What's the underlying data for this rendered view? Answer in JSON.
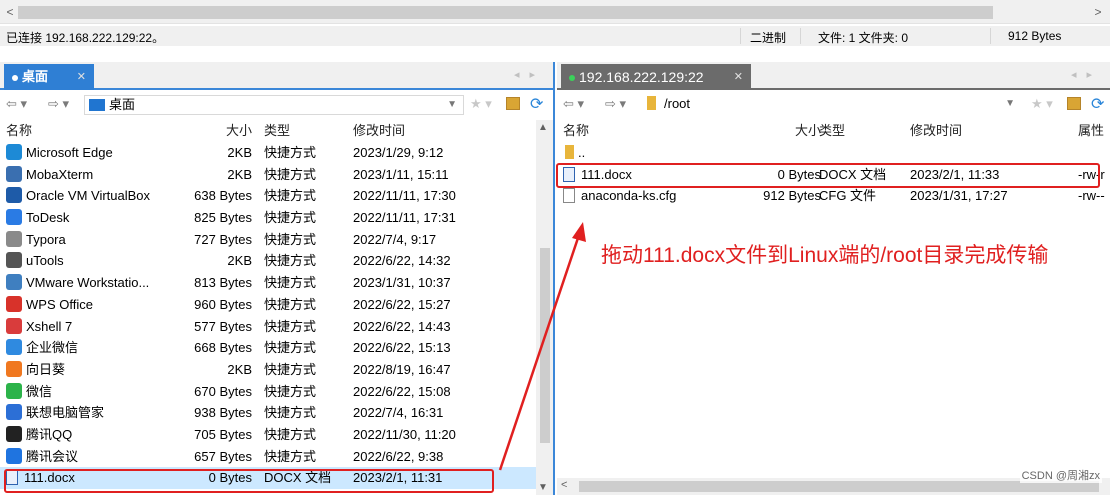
{
  "status_bar": {
    "connection": "已连接 192.168.222.129:22。",
    "mode": "二进制",
    "counts": "文件: 1  文件夹: 0",
    "size": "912 Bytes"
  },
  "left_panel": {
    "tab_label": "桌面",
    "address": "桌面",
    "columns": {
      "name": "名称",
      "size": "大小",
      "type": "类型",
      "modified": "修改时间"
    },
    "files": [
      {
        "name": "Microsoft Edge",
        "size": "2KB",
        "type": "快捷方式",
        "modified": "2023/1/29, 9:12",
        "icon": "edge-icon",
        "color": "#1d8ad6"
      },
      {
        "name": "MobaXterm",
        "size": "2KB",
        "type": "快捷方式",
        "modified": "2023/1/11, 15:11",
        "icon": "mobaxterm-icon",
        "color": "#3a6fb0"
      },
      {
        "name": "Oracle VM VirtualBox",
        "size": "638 Bytes",
        "type": "快捷方式",
        "modified": "2022/11/11, 17:30",
        "icon": "virtualbox-icon",
        "color": "#1e5ba8"
      },
      {
        "name": "ToDesk",
        "size": "825 Bytes",
        "type": "快捷方式",
        "modified": "2022/11/11, 17:31",
        "icon": "todesk-icon",
        "color": "#2a7be4"
      },
      {
        "name": "Typora",
        "size": "727 Bytes",
        "type": "快捷方式",
        "modified": "2022/7/4, 9:17",
        "icon": "typora-icon",
        "color": "#8a8a8a"
      },
      {
        "name": "uTools",
        "size": "2KB",
        "type": "快捷方式",
        "modified": "2022/6/22, 14:32",
        "icon": "utools-icon",
        "color": "#555555"
      },
      {
        "name": "VMware Workstatio...",
        "size": "813 Bytes",
        "type": "快捷方式",
        "modified": "2023/1/31, 10:37",
        "icon": "vmware-icon",
        "color": "#3f7fc0"
      },
      {
        "name": "WPS Office",
        "size": "960 Bytes",
        "type": "快捷方式",
        "modified": "2022/6/22, 15:27",
        "icon": "wps-icon",
        "color": "#d8322a"
      },
      {
        "name": "Xshell 7",
        "size": "577 Bytes",
        "type": "快捷方式",
        "modified": "2022/6/22, 14:43",
        "icon": "xshell-icon",
        "color": "#d93c3c"
      },
      {
        "name": "企业微信",
        "size": "668 Bytes",
        "type": "快捷方式",
        "modified": "2022/6/22, 15:13",
        "icon": "wecom-icon",
        "color": "#2f8ae0"
      },
      {
        "name": "向日葵",
        "size": "2KB",
        "type": "快捷方式",
        "modified": "2022/8/19, 16:47",
        "icon": "sunflower-icon",
        "color": "#f07820"
      },
      {
        "name": "微信",
        "size": "670 Bytes",
        "type": "快捷方式",
        "modified": "2022/6/22, 15:08",
        "icon": "wechat-icon",
        "color": "#2cb34a"
      },
      {
        "name": "联想电脑管家",
        "size": "938 Bytes",
        "type": "快捷方式",
        "modified": "2022/7/4, 16:31",
        "icon": "lenovo-icon",
        "color": "#2c6fd6"
      },
      {
        "name": "腾讯QQ",
        "size": "705 Bytes",
        "type": "快捷方式",
        "modified": "2022/11/30, 11:20",
        "icon": "qq-icon",
        "color": "#222222"
      },
      {
        "name": "腾讯会议",
        "size": "657 Bytes",
        "type": "快捷方式",
        "modified": "2022/6/22, 9:38",
        "icon": "tencent-meeting-icon",
        "color": "#1f74e0"
      },
      {
        "name": "111.docx",
        "size": "0 Bytes",
        "type": "DOCX 文档",
        "modified": "2023/2/1, 11:31",
        "icon": "docx-file-icon",
        "color": "#2f63b0"
      }
    ]
  },
  "right_panel": {
    "tab_label": "192.168.222.129:22",
    "address": "/root",
    "columns": {
      "name": "名称",
      "size": "大小",
      "type": "类型",
      "modified": "修改时间",
      "attributes": "属性"
    },
    "parent_label": "..",
    "files": [
      {
        "name": "111.docx",
        "size": "0 Bytes",
        "type": "DOCX 文档",
        "modified": "2023/2/1, 11:33",
        "attributes": "-rw-r",
        "icon": "docx-file-icon"
      },
      {
        "name": "anaconda-ks.cfg",
        "size": "912 Bytes",
        "type": "CFG 文件",
        "modified": "2023/1/31, 17:27",
        "attributes": "-rw--",
        "icon": "file-icon"
      }
    ]
  },
  "annotation": {
    "text": "拖动111.docx文件到Linux端的/root目录完成传输",
    "color": "#e02020"
  },
  "watermark": "CSDN @周湘zx",
  "colors": {
    "accent": "#3b87d8",
    "selection": "#cce8ff",
    "annotation_red": "#e02020"
  }
}
